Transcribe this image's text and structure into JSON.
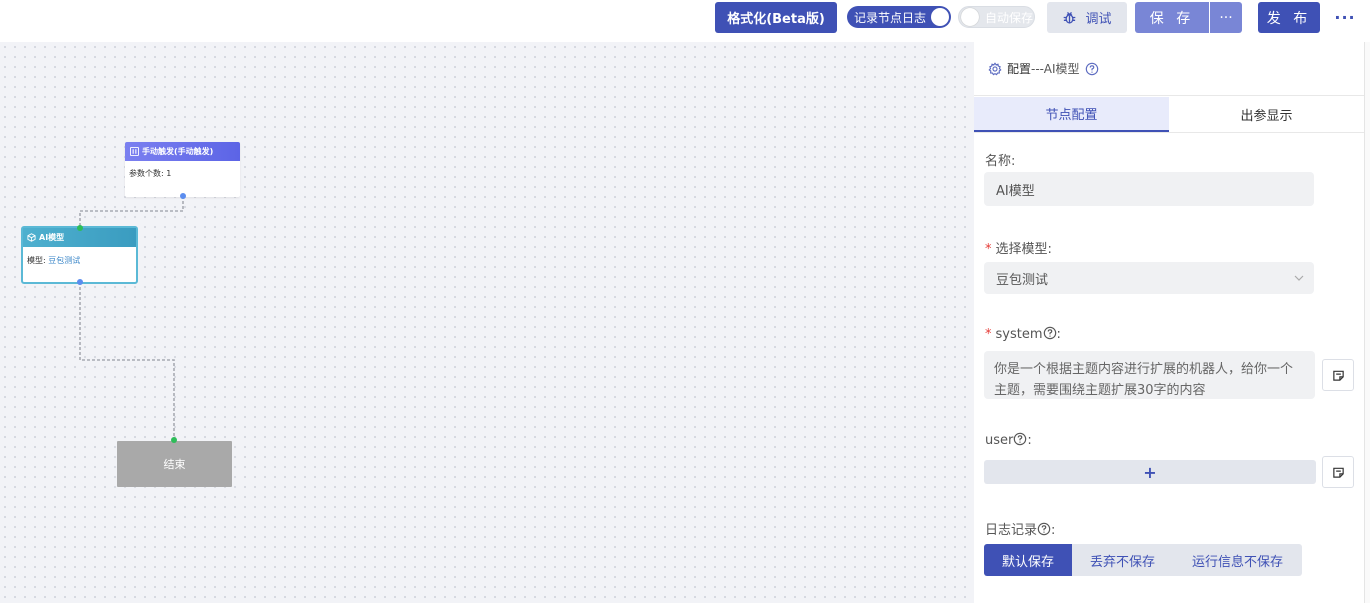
{
  "toolbar": {
    "format_label": "格式化(Beta版)",
    "log_toggle_label": "记录节点日志",
    "autosave_toggle_label": "自动保存",
    "debug_label": "调试",
    "save_label": "保 存",
    "save_more_label": "···",
    "publish_label": "发 布",
    "more_label": "···"
  },
  "canvas": {
    "trigger_node": {
      "title": "手动触发(手动触发)",
      "param_label": "参数个数:",
      "param_value": "1"
    },
    "ai_node": {
      "title": "AI模型",
      "model_label": "模型:",
      "model_value": "豆包测试"
    },
    "end_node": {
      "title": "结束"
    },
    "colors": {
      "trigger": "#6b72ec",
      "ai": "#48a9cb",
      "end": "#a9a9a9",
      "port_blue": "#5b8def",
      "port_green": "#2ebd59"
    }
  },
  "panel": {
    "header_title": "配置",
    "header_suffix": "---AI模型",
    "tabs": [
      {
        "label": "节点配置",
        "active": true
      },
      {
        "label": "出参显示",
        "active": false
      }
    ],
    "name": {
      "label": "名称:",
      "value": "AI模型"
    },
    "model": {
      "label": "选择模型:",
      "value": "豆包测试"
    },
    "system": {
      "label": "system",
      "colon": ":",
      "value": "你是一个根据主题内容进行扩展的机器人，给你一个主题，需要围绕主题扩展30字的内容"
    },
    "user": {
      "label": "user",
      "colon": ":",
      "add_label": "+"
    },
    "log": {
      "label": "日志记录",
      "colon": ":",
      "options": [
        {
          "label": "默认保存",
          "selected": true
        },
        {
          "label": "丢弃不保存",
          "selected": false
        },
        {
          "label": "运行信息不保存",
          "selected": false
        }
      ]
    },
    "accent": "#3f51b5"
  }
}
